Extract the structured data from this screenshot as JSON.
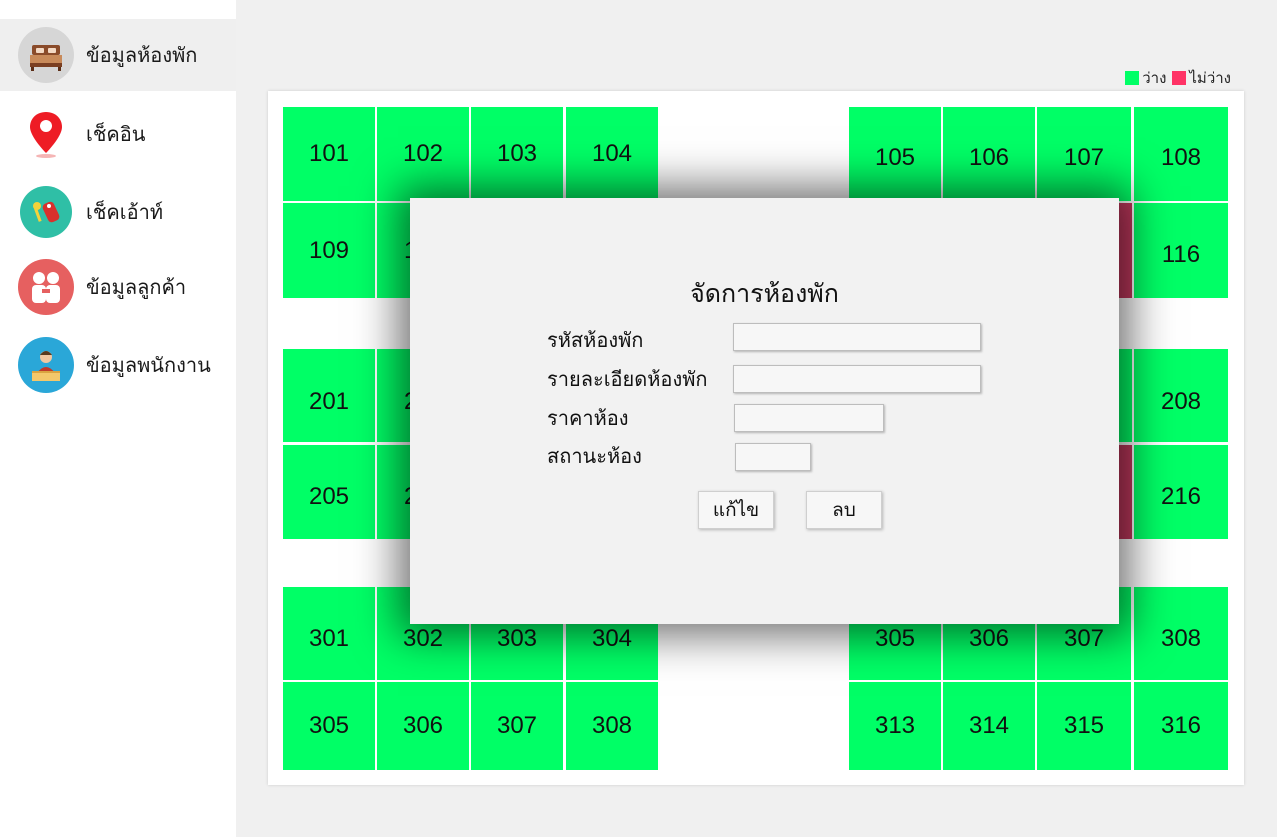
{
  "sidebar": {
    "items": [
      {
        "label": "ข้อมูลห้องพัก",
        "icon": "bed-icon"
      },
      {
        "label": "เช็คอิน",
        "icon": "location-pin-icon"
      },
      {
        "label": "เช็คเอ้าท์",
        "icon": "key-tag-icon"
      },
      {
        "label": "ข้อมูลลูกค้า",
        "icon": "customers-icon"
      },
      {
        "label": "ข้อมูลพนักงาน",
        "icon": "employee-icon"
      }
    ]
  },
  "legend": {
    "available_label": "ว่าง",
    "available_color": "#00ff66",
    "occupied_label": "ไม่ว่าง",
    "occupied_color": "#ff3366"
  },
  "rooms": {
    "r101": "101",
    "r102": "102",
    "r103": "103",
    "r104": "104",
    "r105": "105",
    "r106": "106",
    "r107": "107",
    "r108": "108",
    "r109": "109",
    "r110": "1",
    "r116": "116",
    "r201": "201",
    "r202": "2",
    "r208": "208",
    "r205": "205",
    "r206": "2",
    "r216": "216",
    "r301": "301",
    "r302": "302",
    "r303": "303",
    "r304": "304",
    "r305a": "305",
    "r306a": "306",
    "r307a": "307",
    "r308a": "308",
    "r305b": "305",
    "r306b": "306",
    "r307b": "307",
    "r308b": "308",
    "r313": "313",
    "r314": "314",
    "r315": "315",
    "r316": "316"
  },
  "modal": {
    "title": "จัดการห้องพัก",
    "room_code_label": "รหัสห้องพัก",
    "room_detail_label": "รายละเอียดห้องพัก",
    "room_price_label": "ราคาห้อง",
    "room_status_label": "สถานะห้อง",
    "room_code_value": "",
    "room_detail_value": "",
    "room_price_value": "",
    "room_status_value": "",
    "edit_button": "แก้ไข",
    "delete_button": "ลบ"
  }
}
